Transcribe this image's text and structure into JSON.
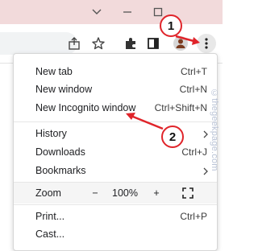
{
  "window": {
    "controls": {
      "minimize_icon": "minimize-icon",
      "maximize_icon": "maximize-icon"
    }
  },
  "toolbar": {
    "icons": [
      "share-icon",
      "star-icon",
      "extensions-icon",
      "side-panel-icon",
      "profile-icon",
      "more-menu-icon"
    ]
  },
  "menu": {
    "items": [
      {
        "label": "New tab",
        "shortcut": "Ctrl+T"
      },
      {
        "label": "New window",
        "shortcut": "Ctrl+N"
      },
      {
        "label": "New Incognito window",
        "shortcut": "Ctrl+Shift+N"
      },
      {
        "label": "History",
        "shortcut": ""
      },
      {
        "label": "Downloads",
        "shortcut": "Ctrl+J"
      },
      {
        "label": "Bookmarks",
        "shortcut": ""
      },
      {
        "label": "Print...",
        "shortcut": "Ctrl+P"
      },
      {
        "label": "Cast...",
        "shortcut": ""
      }
    ],
    "zoom": {
      "label": "Zoom",
      "minus": "−",
      "value": "100%",
      "plus": "+"
    }
  },
  "annotations": {
    "badge1": "1",
    "badge2": "2"
  },
  "watermark": "©thegeekpage.com",
  "colors": {
    "titlebar": "#f2dadb",
    "annotation_red": "#e0242a",
    "badge_bg": "#ffffff"
  }
}
